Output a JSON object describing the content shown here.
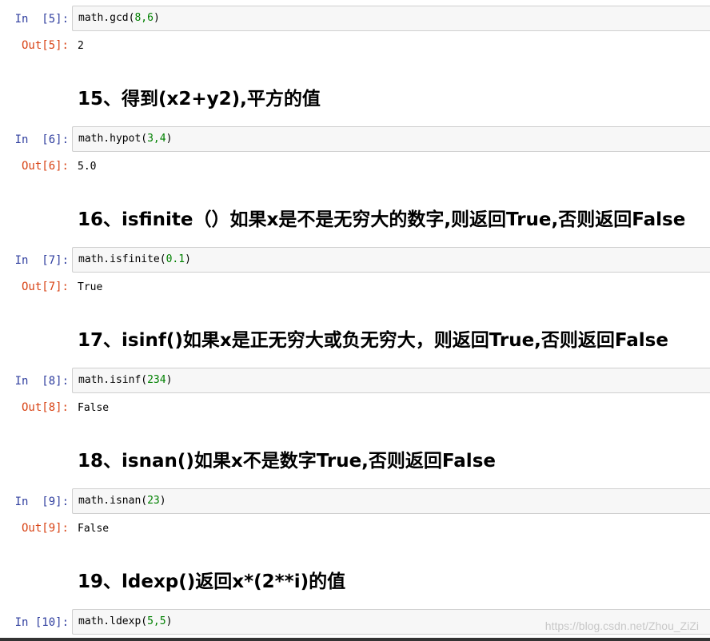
{
  "cells": [
    {
      "in_prompt": "In  [5]:",
      "code_fn": "math.gcd(",
      "code_args": "8,6",
      "code_close": ")",
      "out_prompt": "Out[5]:",
      "output": "2"
    },
    {
      "heading": "15、得到(x2+y2),平方的值"
    },
    {
      "in_prompt": "In  [6]:",
      "code_fn": "math.hypot(",
      "code_args": "3,4",
      "code_close": ")",
      "out_prompt": "Out[6]:",
      "output": "5.0"
    },
    {
      "heading": "16、isfinite（）如果x是不是无穷大的数字,则返回True,否则返回False"
    },
    {
      "in_prompt": "In  [7]:",
      "code_fn": "math.isfinite(",
      "code_args": "0.1",
      "code_close": ")",
      "out_prompt": "Out[7]:",
      "output": "True"
    },
    {
      "heading": "17、isinf()如果x是正无穷大或负无穷大，则返回True,否则返回False"
    },
    {
      "in_prompt": "In  [8]:",
      "code_fn": "math.isinf(",
      "code_args": "234",
      "code_close": ")",
      "out_prompt": "Out[8]:",
      "output": "False"
    },
    {
      "heading": "18、isnan()如果x不是数字True,否则返回False"
    },
    {
      "in_prompt": "In  [9]:",
      "code_fn": "math.isnan(",
      "code_args": "23",
      "code_close": ")",
      "out_prompt": "Out[9]:",
      "output": "False"
    },
    {
      "heading": "19、ldexp()返回x*(2**i)的值"
    },
    {
      "in_prompt": "In [10]:",
      "code_fn": "math.ldexp(",
      "code_args": "5,5",
      "code_close": ")"
    }
  ],
  "watermark": "https://blog.csdn.net/Zhou_ZiZi",
  "colors": {
    "in_prompt": "#303f9f",
    "out_prompt": "#d84315",
    "number": "#008000",
    "cell_bg": "#f7f7f7"
  }
}
